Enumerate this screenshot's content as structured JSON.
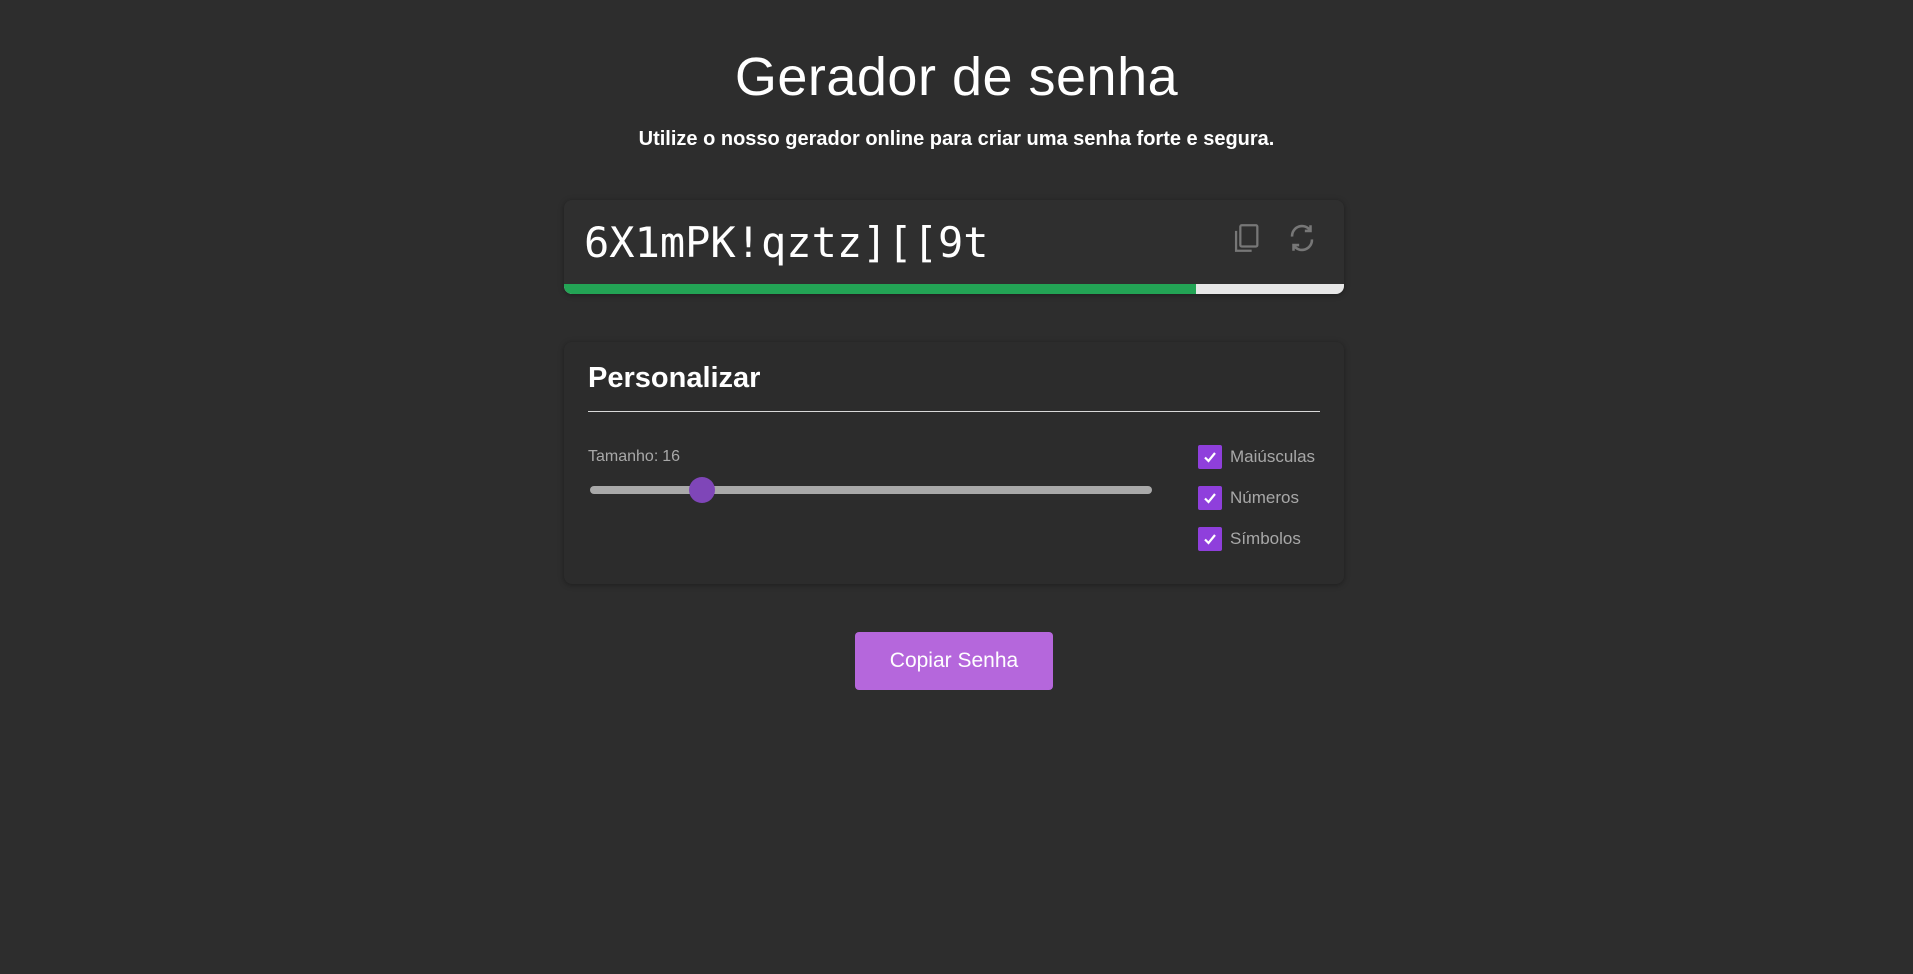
{
  "header": {
    "title": "Gerador de senha",
    "subtitle": "Utilize o nosso gerador online para criar uma senha forte e segura."
  },
  "password": {
    "value": "6X1mPK!qztz][[9t",
    "strength_percent": 81,
    "copy_icon": "copy-icon",
    "refresh_icon": "refresh-icon"
  },
  "customize": {
    "title": "Personalizar",
    "length_label": "Tamanho:",
    "length_value": "16",
    "slider": {
      "value": 16,
      "min": 4,
      "max": 64
    },
    "options": [
      {
        "label": "Maiúsculas",
        "checked": true
      },
      {
        "label": "Números",
        "checked": true
      },
      {
        "label": "Símbolos",
        "checked": true
      }
    ]
  },
  "actions": {
    "copy_label": "Copiar Senha"
  },
  "colors": {
    "background": "#2d2d2d",
    "accent": "#b567dc",
    "checkbox": "#8f3fdc",
    "slider_thumb": "#7f46b8",
    "strength": "#23a455"
  }
}
